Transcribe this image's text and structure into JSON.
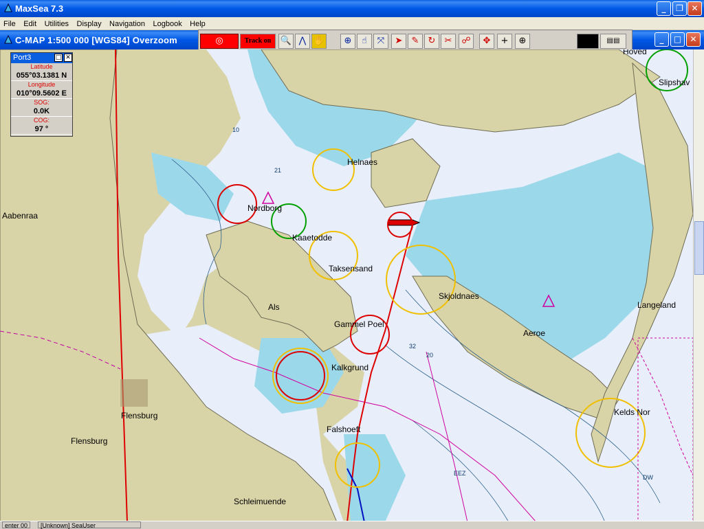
{
  "app": {
    "title": "MaxSea 7.3"
  },
  "menu": [
    "File",
    "Edit",
    "Utilities",
    "Display",
    "Navigation",
    "Logbook",
    "Help"
  ],
  "chart_window": {
    "title": "C-MAP  1:500 000 [WGS84]    Overzoom"
  },
  "toolbar": {
    "track_label": "Track on"
  },
  "port_window": {
    "title": "Port3",
    "rows": [
      {
        "label": "Latitude",
        "value": "055°03.1381 N"
      },
      {
        "label": "Longitude",
        "value": "010°09.5602 E"
      },
      {
        "label": "SOG:",
        "value": "0.0K"
      },
      {
        "label": "COG:",
        "value": "97 °"
      }
    ]
  },
  "map": {
    "place_names": [
      "Helnaes",
      "Nordborg",
      "Kaaetodde",
      "Taksensand",
      "Skjoldnaes",
      "Als",
      "Gammel Poel",
      "Aeroe",
      "Langeland",
      "Kalkgrund",
      "Flensburg",
      "Flensburg",
      "Falshoeft",
      "Kelds Nor",
      "Schleimuende",
      "Aabenraa",
      "Slipshav",
      "Hoved"
    ],
    "depth_labels": [
      "21",
      "32",
      "10",
      "20",
      "DW",
      "EEZ"
    ]
  },
  "status": {
    "left": "enter 00",
    "user": "[Unknown] SeaUser"
  },
  "colors": {
    "land": "#d9d3a8",
    "shallow": "#9bd8ea",
    "deep": "#e8eefa",
    "route": "#dd0000",
    "light_circle": "#f0c000"
  }
}
